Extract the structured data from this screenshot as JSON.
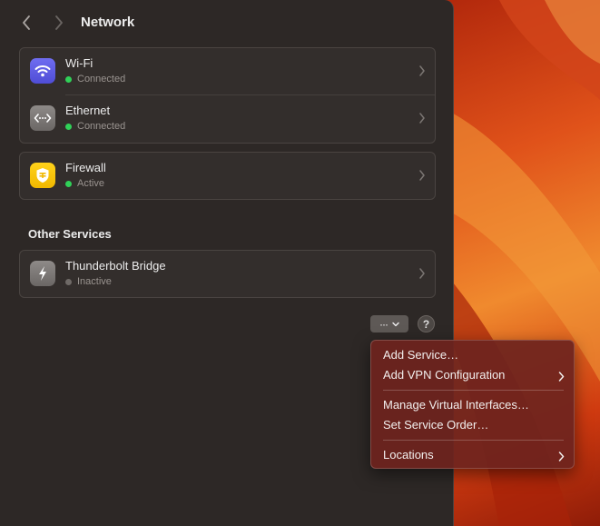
{
  "window": {
    "title": "Network"
  },
  "services": [
    {
      "name": "Wi-Fi",
      "status": "Connected",
      "icon": "wifi-icon",
      "status_color": "#30d158"
    },
    {
      "name": "Ethernet",
      "status": "Connected",
      "icon": "ethernet-icon",
      "status_color": "#30d158"
    }
  ],
  "firewall": {
    "name": "Firewall",
    "status": "Active",
    "icon": "firewall-icon",
    "status_color": "#30d158"
  },
  "other_services": {
    "title": "Other Services",
    "items": [
      {
        "name": "Thunderbolt Bridge",
        "status": "Inactive",
        "icon": "thunderbolt-icon",
        "status_color": "#8e8e93"
      }
    ]
  },
  "actions": {
    "more_label": "···",
    "help_label": "?"
  },
  "menu": {
    "items": [
      {
        "label": "Add Service…",
        "submenu": false
      },
      {
        "label": "Add VPN Configuration",
        "submenu": true
      },
      {
        "label": "Manage Virtual Interfaces…",
        "submenu": false
      },
      {
        "label": "Set Service Order…",
        "submenu": false
      },
      {
        "label": "Locations",
        "submenu": true
      }
    ]
  },
  "colors": {
    "accent_wifi": "#5e5ce6",
    "firewall_yellow": "#f5c400",
    "connected": "#30d158",
    "inactive": "#8e8e93"
  }
}
